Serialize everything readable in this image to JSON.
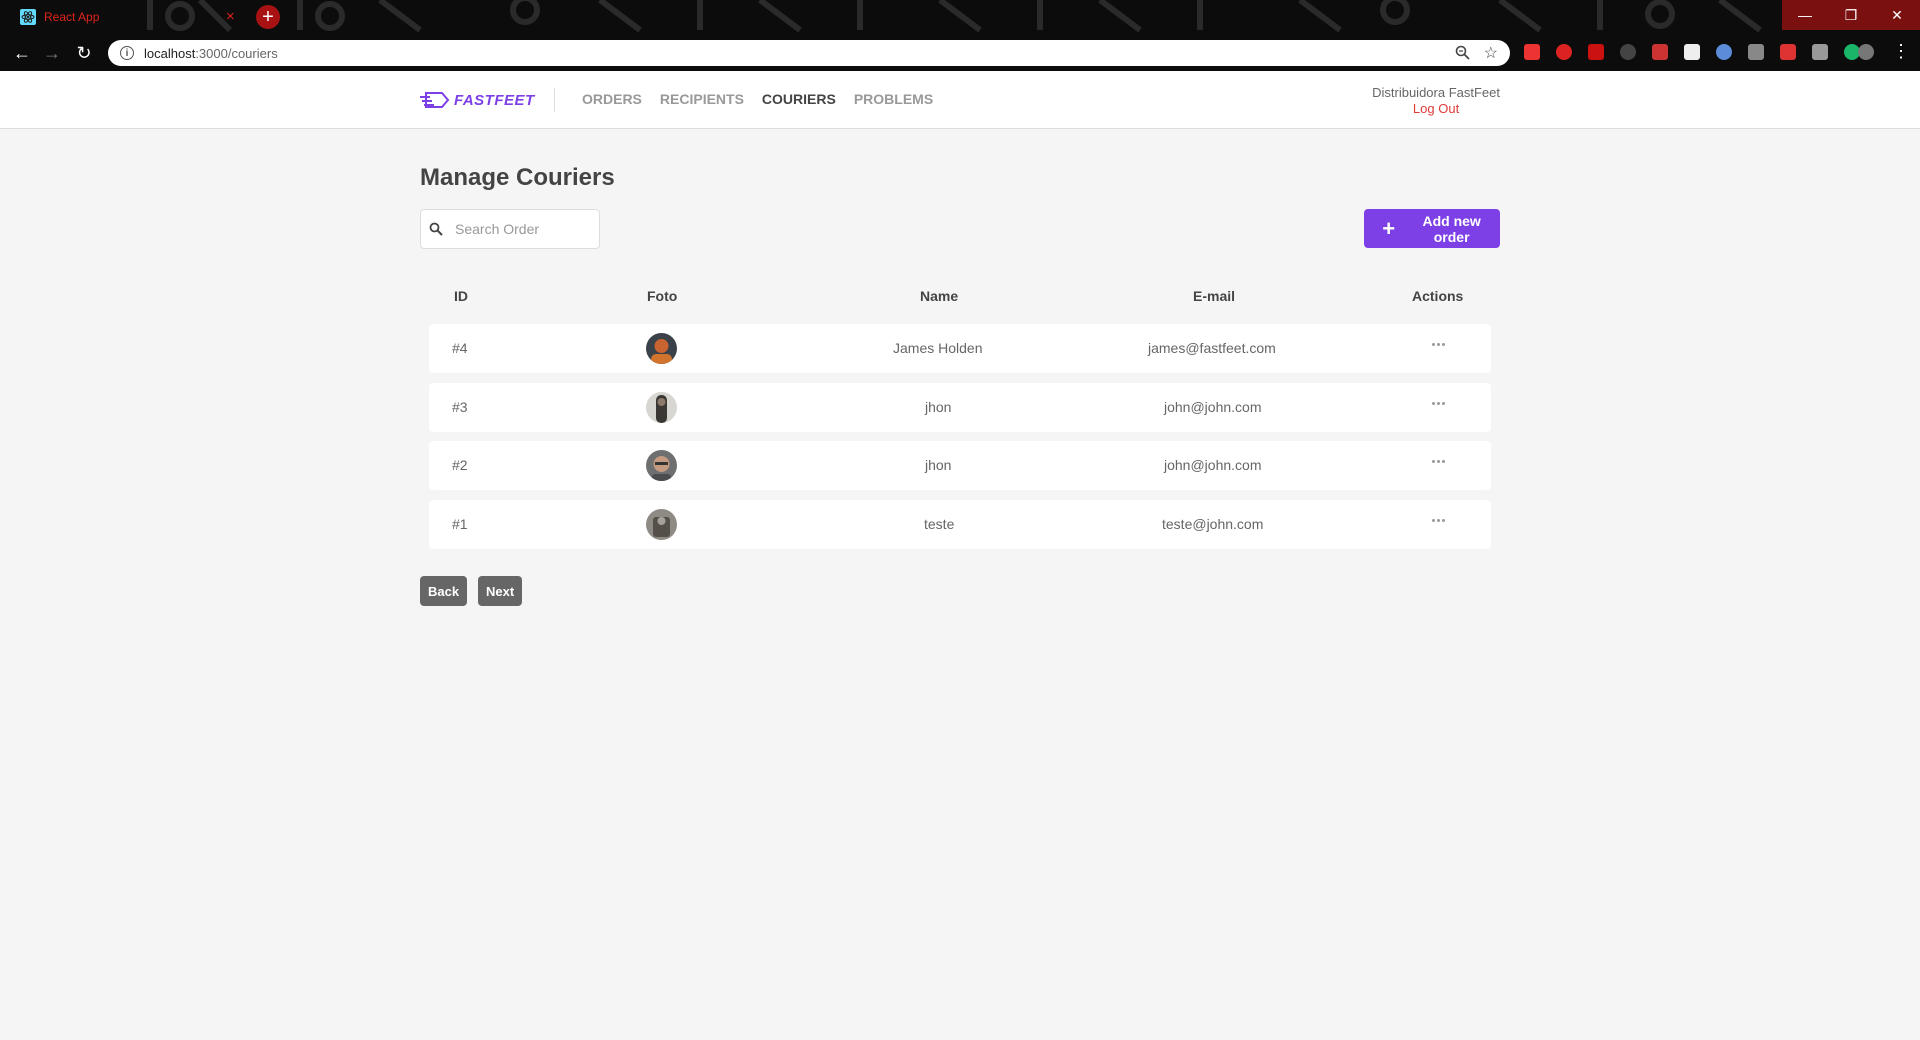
{
  "browser": {
    "tab_title": "React App",
    "tab_close": "×",
    "new_tab": "+",
    "url_host": "localhost",
    "url_rest": ":3000/couriers"
  },
  "app": {
    "brand": "FASTFEET",
    "nav": [
      {
        "label": "ORDERS",
        "active": false
      },
      {
        "label": "RECIPIENTS",
        "active": false
      },
      {
        "label": "COURIERS",
        "active": true
      },
      {
        "label": "PROBLEMS",
        "active": false
      }
    ],
    "user_name": "Distribuidora FastFeet",
    "logout_label": "Log Out"
  },
  "page": {
    "title": "Manage Couriers",
    "search_placeholder": "Search Order",
    "add_button_label": "Add new order"
  },
  "table": {
    "headers": {
      "id": "ID",
      "photo": "Foto",
      "name": "Name",
      "email": "E-mail",
      "actions": "Actions"
    },
    "rows": [
      {
        "id": "#4",
        "name": "James Holden",
        "email": "james@fastfeet.com",
        "avatar": "avatar-james"
      },
      {
        "id": "#3",
        "name": "jhon",
        "email": "john@john.com",
        "avatar": "avatar-jhon-3"
      },
      {
        "id": "#2",
        "name": "jhon",
        "email": "john@john.com",
        "avatar": "avatar-jhon-2"
      },
      {
        "id": "#1",
        "name": "teste",
        "email": "teste@john.com",
        "avatar": "avatar-teste"
      }
    ]
  },
  "pagination": {
    "back_label": "Back",
    "next_label": "Next"
  },
  "colors": {
    "brand": "#7d40e7",
    "logout": "#de3b3b",
    "pager": "#666666",
    "chrome_accent": "#a81212"
  }
}
